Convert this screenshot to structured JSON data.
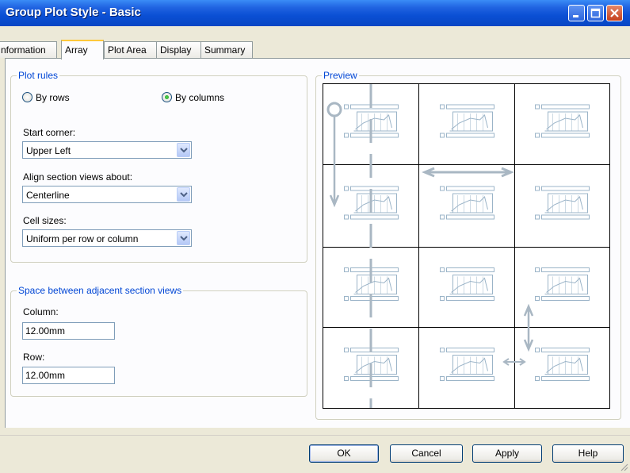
{
  "window": {
    "title": "Group Plot Style - Basic"
  },
  "tabs": [
    {
      "label": "nformation"
    },
    {
      "label": "Array"
    },
    {
      "label": "Plot Area"
    },
    {
      "label": "Display"
    },
    {
      "label": "Summary"
    }
  ],
  "plot_rules": {
    "legend": "Plot rules",
    "by_rows_label": "By rows",
    "by_columns_label": "By columns",
    "selected": "By columns",
    "start_corner_label": "Start corner:",
    "start_corner_value": "Upper Left",
    "align_label": "Align section views about:",
    "align_value": "Centerline",
    "cell_sizes_label": "Cell sizes:",
    "cell_sizes_value": "Uniform per row or column"
  },
  "spacing": {
    "legend": "Space between adjacent section views",
    "column_label": "Column:",
    "column_value": "12.00mm",
    "row_label": "Row:",
    "row_value": "12.00mm"
  },
  "preview": {
    "legend": "Preview",
    "rows": 4,
    "columns": 3
  },
  "buttons": {
    "ok": "OK",
    "cancel": "Cancel",
    "apply": "Apply",
    "help": "Help"
  },
  "colors": {
    "titlebar": "#0a4fd4",
    "legend_text": "#0046d5",
    "preview_glyph": "#9bb4c8"
  }
}
